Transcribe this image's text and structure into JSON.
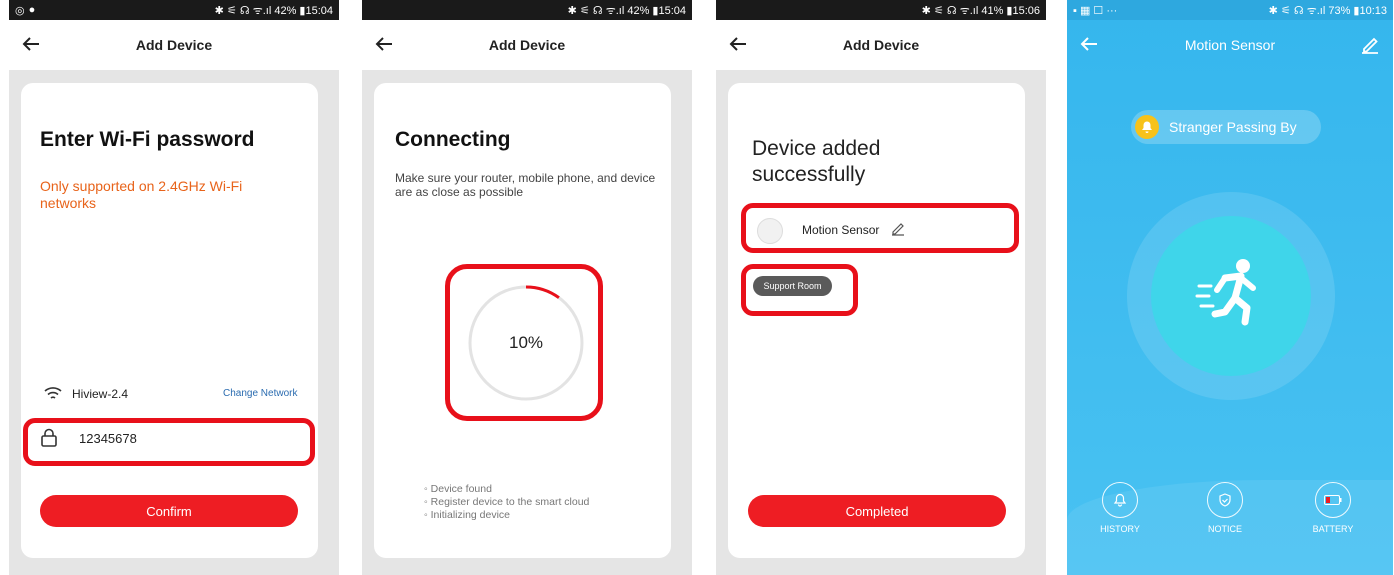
{
  "screen1": {
    "status_right": "✱ ⚟ ☊ ᯤ.ıl 42% ▮15:04",
    "title": "Add Device",
    "heading": "Enter Wi-Fi password",
    "note": "Only supported on 2.4GHz Wi-Fi networks",
    "wifi_name": "Hiview-2.4",
    "change_network": "Change Network",
    "password_value": "12345678",
    "confirm_label": "Confirm"
  },
  "screen2": {
    "status_right": "✱ ⚟ ☊ ᯤ.ıl 42% ▮15:04",
    "title": "Add Device",
    "heading": "Connecting",
    "subtitle": "Make sure your router, mobile phone, and device are as close as possible",
    "progress_label": "10%",
    "progress_value": 10,
    "steps": [
      "Device found",
      "Register device to the smart cloud",
      "Initializing device"
    ]
  },
  "screen3": {
    "status_right": "✱ ⚟ ☊ ᯤ.ıl 41% ▮15:06",
    "title": "Add Device",
    "heading_line1": "Device added",
    "heading_line2": "successfully",
    "device_name": "Motion Sensor",
    "support_room": "Support Room",
    "completed_label": "Completed"
  },
  "screen4": {
    "status_left": "▪ ▦ ☐ ···",
    "status_right": "✱ ⚟ ☊ ᯤ.ıl 73% ▮10:13",
    "title": "Motion Sensor",
    "alert_text": "Stranger Passing By",
    "nav": [
      "HISTORY",
      "NOTICE",
      "BATTERY"
    ]
  },
  "colors": {
    "red": "#ee1d23",
    "orange": "#e8631a",
    "blue_link": "#2b6cb0",
    "teal": "#3fd5ea",
    "sky": "#35b6ed"
  }
}
